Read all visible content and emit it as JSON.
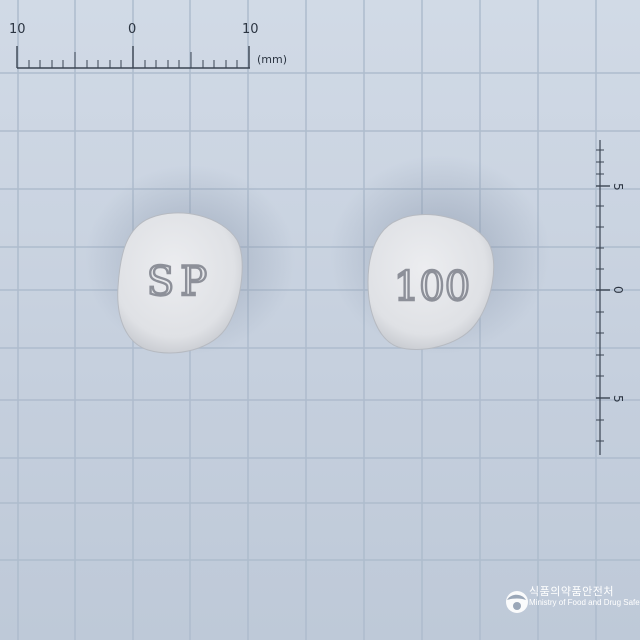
{
  "ruler": {
    "top_labels": [
      "10",
      "0",
      "10"
    ],
    "unit": "(mm)",
    "side_labels": [
      "5",
      "0",
      "5"
    ]
  },
  "tablets": [
    {
      "imprint": "SP",
      "color": "#e4e6ea"
    },
    {
      "imprint": "100",
      "color": "#e6e7ea"
    }
  ],
  "watermark": {
    "korean": "식품의약품안전처",
    "english": "Ministry of Food and Drug Safety"
  },
  "colors": {
    "background": "#c9d3e0",
    "grid_line": "#aebccd",
    "tablet": "#e4e6ea"
  }
}
